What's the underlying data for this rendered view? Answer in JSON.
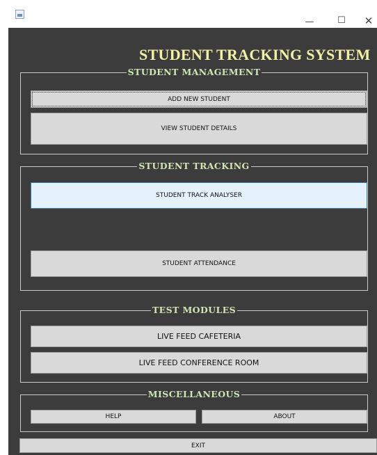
{
  "window": {
    "minimize_glyph": "—",
    "maximize_glyph": "☐",
    "close_glyph": "✕"
  },
  "app_title": "STUDENT TRACKING SYSTEM",
  "groups": {
    "management": {
      "title": "STUDENT  MANAGEMENT",
      "add_label": "ADD NEW STUDENT",
      "view_label": "VIEW STUDENT DETAILS"
    },
    "tracking": {
      "title": "STUDENT  TRACKING",
      "analyser_label": "STUDENT TRACK ANALYSER",
      "attendance_label": "STUDENT ATTENDANCE"
    },
    "test": {
      "title": "TEST MODULES",
      "cafeteria_label": "LIVE FEED CAFETERIA",
      "conference_label": "LIVE FEED CONFERENCE ROOM"
    },
    "misc": {
      "title": "MISCELLANEOUS",
      "help_label": "HELP",
      "about_label": "ABOUT"
    }
  },
  "exit_label": "EXIT",
  "colors": {
    "background": "#3c3c3c",
    "title": "#f4f0a6",
    "legend": "#cfe6b4",
    "button": "#d9d9d9",
    "hover": "#e5f1fb"
  }
}
